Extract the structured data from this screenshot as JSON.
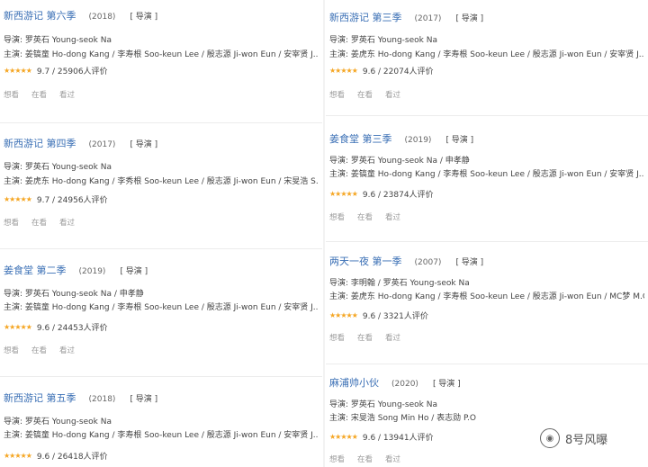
{
  "left": [
    {
      "title": "新西游记 第六季",
      "year": "(2018)",
      "tag": "[ 导演 ]",
      "director": "导演: 罗英石 Young-seok Na",
      "cast": "主演: 姜镐童 Ho-dong Kang / 李寿根 Soo-keun Lee / 殷志源 Ji-won Eun / 安宰贤 J...",
      "rating": "9.7 / 25906人评价",
      "actions": [
        "想看",
        "在看",
        "看过"
      ]
    },
    {
      "title": "新西游记 第四季",
      "year": "(2017)",
      "tag": "[ 导演 ]",
      "director": "导演: 罗英石 Young-seok Na",
      "cast": "主演: 姜虎东 Ho-dong Kang / 李秀根 Soo-keun Lee / 殷志源 Ji-won Eun / 宋旻浩 S...",
      "rating": "9.7 / 24956人评价",
      "actions": [
        "想看",
        "在看",
        "看过"
      ]
    },
    {
      "title": "姜食堂 第二季",
      "year": "(2019)",
      "tag": "[ 导演 ]",
      "director": "导演: 罗英石 Young-seok Na / 申孝静",
      "cast": "主演: 姜镐童 Ho-dong Kang / 李寿根 Soo-keun Lee / 殷志源 Ji-won Eun / 安宰贤 J...",
      "rating": "9.6 / 24453人评价",
      "actions": [
        "想看",
        "在看",
        "看过"
      ]
    },
    {
      "title": "新西游记 第五季",
      "year": "(2018)",
      "tag": "[ 导演 ]",
      "director": "导演: 罗英石 Young-seok Na",
      "cast": "主演: 姜镐童 Ho-dong Kang / 李寿根 Soo-keun Lee / 殷志源 Ji-won Eun / 安宰贤 J...",
      "rating": "9.6 / 26418人评价",
      "actions": []
    }
  ],
  "right": [
    {
      "title": "新西游记 第三季",
      "year": "(2017)",
      "tag": "[ 导演 ]",
      "director": "导演: 罗英石 Young-seok Na",
      "cast": "主演: 姜虎东 Ho-dong Kang / 李寿根 Soo-keun Lee / 殷志源 Ji-won Eun / 安宰贤 J...",
      "rating": "9.6 / 22074人评价",
      "actions": [
        "想看",
        "在看",
        "看过"
      ]
    },
    {
      "title": "姜食堂 第三季",
      "year": "(2019)",
      "tag": "[ 导演 ]",
      "director": "导演: 罗英石 Young-seok Na / 申孝静",
      "cast": "主演: 姜镐童 Ho-dong Kang / 李寿根 Soo-keun Lee / 殷志源 Ji-won Eun / 安宰贤 J...",
      "rating": "9.6 / 23874人评价",
      "actions": [
        "想看",
        "在看",
        "看过"
      ]
    },
    {
      "title": "两天一夜 第一季",
      "year": "(2007)",
      "tag": "[ 导演 ]",
      "director": "导演: 李明翰 / 罗英石 Young-seok Na",
      "cast": "主演: 姜虎东 Ho-dong Kang / 李寿根 Soo-keun Lee / 殷志源 Ji-won Eun / MC梦 M.C...",
      "rating": "9.6 / 3321人评价",
      "actions": [
        "想看",
        "在看",
        "看过"
      ]
    },
    {
      "title": "麻浦帅小伙",
      "year": "(2020)",
      "tag": "[ 导演 ]",
      "director": "导演: 罗英石 Young-seok Na",
      "cast": "主演: 宋旻浩 Song Min Ho / 表志勋 P.O",
      "rating": "9.6 / 13941人评价",
      "actions": [
        "想看",
        "在看",
        "看过"
      ]
    }
  ],
  "stars": "★★★★★",
  "watermark": "8号风曝"
}
